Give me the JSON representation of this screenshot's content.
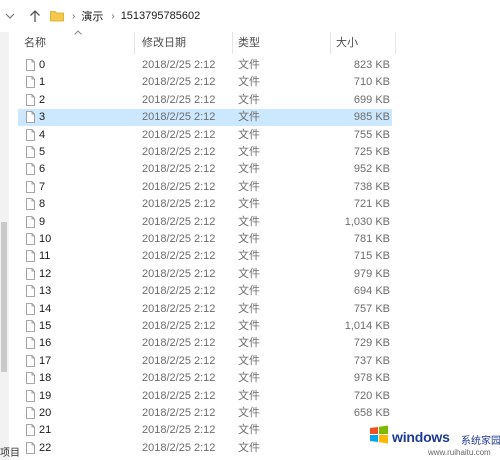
{
  "address_bar": {
    "crumbs": [
      "演示",
      "1513795785602"
    ]
  },
  "columns": {
    "name": "名称",
    "date": "修改日期",
    "type": "类型",
    "size": "大小"
  },
  "files": [
    {
      "name": "0",
      "date": "2018/2/25 2:12",
      "type": "文件",
      "size": "823 KB"
    },
    {
      "name": "1",
      "date": "2018/2/25 2:12",
      "type": "文件",
      "size": "710 KB"
    },
    {
      "name": "2",
      "date": "2018/2/25 2:12",
      "type": "文件",
      "size": "699 KB"
    },
    {
      "name": "3",
      "date": "2018/2/25 2:12",
      "type": "文件",
      "size": "985 KB",
      "selected": true
    },
    {
      "name": "4",
      "date": "2018/2/25 2:12",
      "type": "文件",
      "size": "755 KB"
    },
    {
      "name": "5",
      "date": "2018/2/25 2:12",
      "type": "文件",
      "size": "725 KB"
    },
    {
      "name": "6",
      "date": "2018/2/25 2:12",
      "type": "文件",
      "size": "952 KB"
    },
    {
      "name": "7",
      "date": "2018/2/25 2:12",
      "type": "文件",
      "size": "738 KB"
    },
    {
      "name": "8",
      "date": "2018/2/25 2:12",
      "type": "文件",
      "size": "721 KB"
    },
    {
      "name": "9",
      "date": "2018/2/25 2:12",
      "type": "文件",
      "size": "1,030 KB"
    },
    {
      "name": "10",
      "date": "2018/2/25 2:12",
      "type": "文件",
      "size": "781 KB"
    },
    {
      "name": "11",
      "date": "2018/2/25 2:12",
      "type": "文件",
      "size": "715 KB"
    },
    {
      "name": "12",
      "date": "2018/2/25 2:12",
      "type": "文件",
      "size": "979 KB"
    },
    {
      "name": "13",
      "date": "2018/2/25 2:12",
      "type": "文件",
      "size": "694 KB"
    },
    {
      "name": "14",
      "date": "2018/2/25 2:12",
      "type": "文件",
      "size": "757 KB"
    },
    {
      "name": "15",
      "date": "2018/2/25 2:12",
      "type": "文件",
      "size": "1,014 KB"
    },
    {
      "name": "16",
      "date": "2018/2/25 2:12",
      "type": "文件",
      "size": "729 KB"
    },
    {
      "name": "17",
      "date": "2018/2/25 2:12",
      "type": "文件",
      "size": "737 KB"
    },
    {
      "name": "18",
      "date": "2018/2/25 2:12",
      "type": "文件",
      "size": "978 KB"
    },
    {
      "name": "19",
      "date": "2018/2/25 2:12",
      "type": "文件",
      "size": "720 KB"
    },
    {
      "name": "20",
      "date": "2018/2/25 2:12",
      "type": "文件",
      "size": "658 KB"
    },
    {
      "name": "21",
      "date": "2018/2/25 2:12",
      "type": "文件",
      "size": ""
    },
    {
      "name": "22",
      "date": "2018/2/25 2:12",
      "type": "文件",
      "size": ""
    }
  ],
  "status_bar": {
    "text": "项目"
  },
  "watermark": {
    "brand": "windows",
    "brand_cn": "系统家园",
    "url": "www.ruihaitu.com"
  },
  "colors": {
    "selected_row": "#cce8ff",
    "folder": "#f2c94c"
  }
}
